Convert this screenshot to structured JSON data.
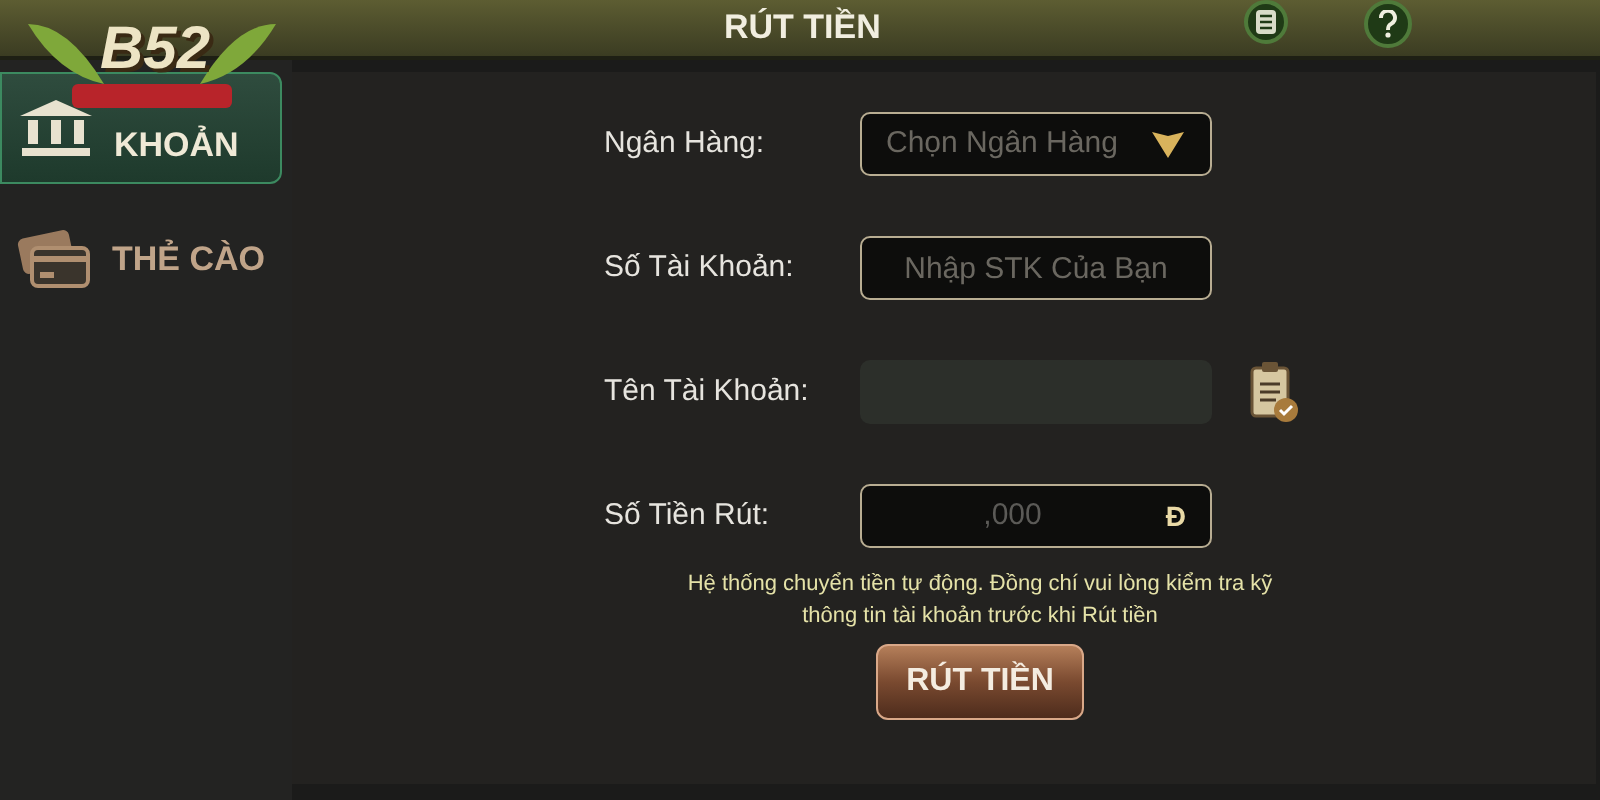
{
  "header": {
    "title": "RÚT TIỀN"
  },
  "logo": {
    "text": "B52"
  },
  "sidebar": {
    "items": [
      {
        "label": "KHOẢN",
        "kind": "bank",
        "selected": true
      },
      {
        "label": "THẺ CÀO",
        "kind": "card",
        "selected": false
      }
    ]
  },
  "form": {
    "fields": [
      {
        "label": "Ngân Hàng:",
        "kind": "select",
        "placeholder": "Chọn Ngân Hàng"
      },
      {
        "label": "Số Tài Khoản:",
        "kind": "input",
        "placeholder": "Nhập STK Của Bạn"
      },
      {
        "label": "Tên Tài Khoản:",
        "kind": "readonly"
      },
      {
        "label": "Số Tiền Rút:",
        "kind": "amount",
        "placeholder": ",000",
        "suffix": "Đ"
      }
    ],
    "notice": "Hệ thống chuyển tiền tự động. Đồng chí vui lòng kiểm tra kỹ thông tin tài khoản trước khi Rút tiền",
    "submit": "RÚT TIỀN"
  }
}
